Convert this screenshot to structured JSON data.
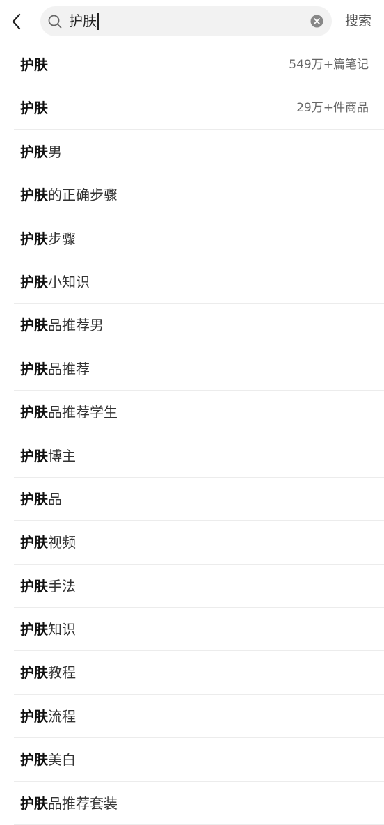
{
  "search": {
    "query": "护肤",
    "button_label": "搜索"
  },
  "suggestions": [
    {
      "keyword": "护肤",
      "suffix": "",
      "meta": "549万+篇笔记"
    },
    {
      "keyword": "护肤",
      "suffix": "",
      "meta": "29万+件商品"
    },
    {
      "keyword": "护肤",
      "suffix": "男",
      "meta": ""
    },
    {
      "keyword": "护肤",
      "suffix": "的正确步骤",
      "meta": ""
    },
    {
      "keyword": "护肤",
      "suffix": "步骤",
      "meta": ""
    },
    {
      "keyword": "护肤",
      "suffix": "小知识",
      "meta": ""
    },
    {
      "keyword": "护肤",
      "suffix": "品推荐男",
      "meta": ""
    },
    {
      "keyword": "护肤",
      "suffix": "品推荐",
      "meta": ""
    },
    {
      "keyword": "护肤",
      "suffix": "品推荐学生",
      "meta": ""
    },
    {
      "keyword": "护肤",
      "suffix": "博主",
      "meta": ""
    },
    {
      "keyword": "护肤",
      "suffix": "品",
      "meta": ""
    },
    {
      "keyword": "护肤",
      "suffix": "视频",
      "meta": ""
    },
    {
      "keyword": "护肤",
      "suffix": "手法",
      "meta": ""
    },
    {
      "keyword": "护肤",
      "suffix": "知识",
      "meta": ""
    },
    {
      "keyword": "护肤",
      "suffix": "教程",
      "meta": ""
    },
    {
      "keyword": "护肤",
      "suffix": "流程",
      "meta": ""
    },
    {
      "keyword": "护肤",
      "suffix": "美白",
      "meta": ""
    },
    {
      "keyword": "护肤",
      "suffix": "品推荐套装",
      "meta": ""
    }
  ]
}
